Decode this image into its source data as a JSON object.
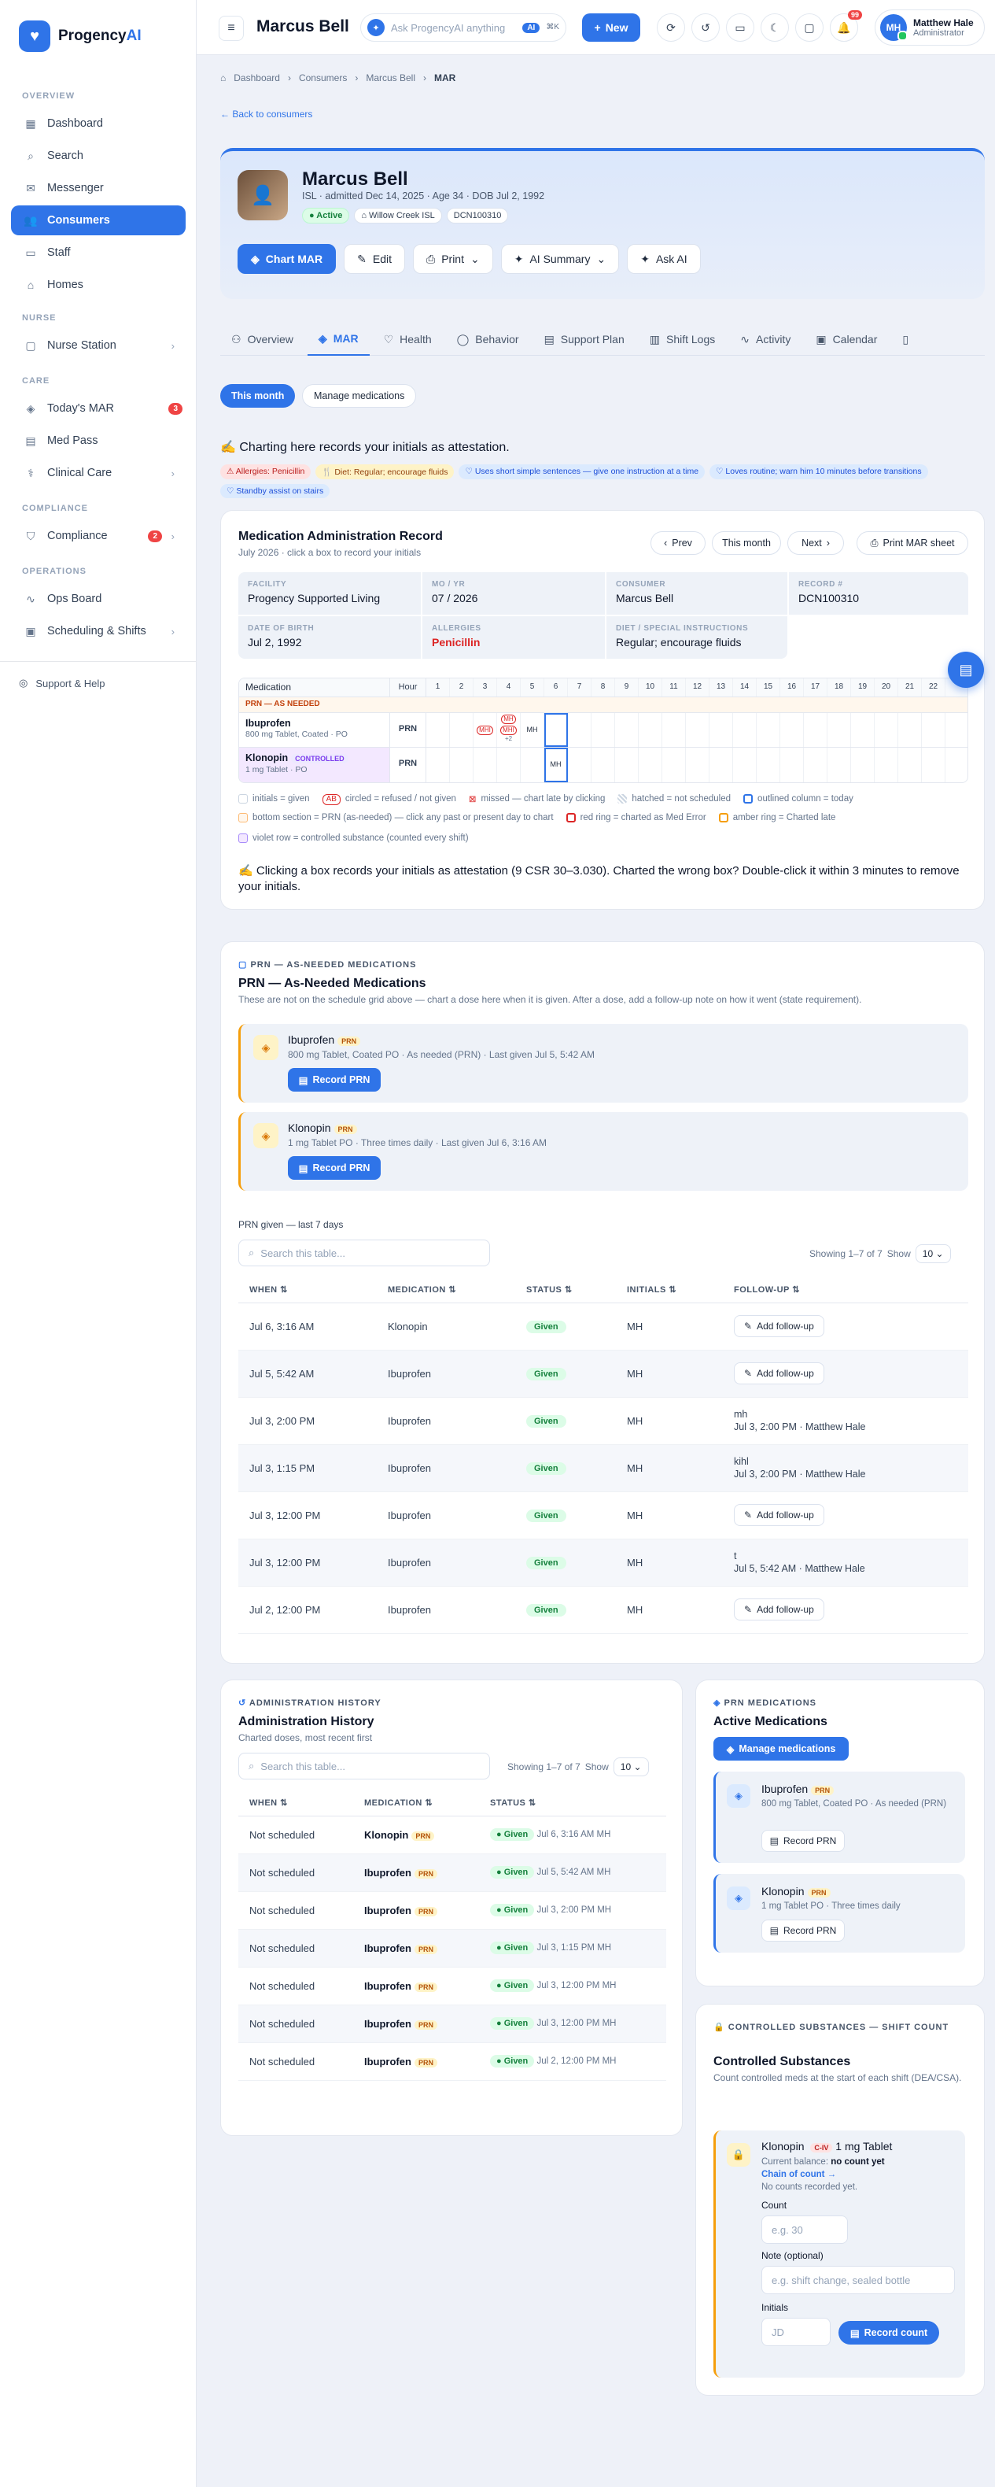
{
  "app": {
    "name_part1": "Progency",
    "name_part2": "AI"
  },
  "sidebar": {
    "sections": [
      "OVERVIEW",
      "NURSE",
      "CARE",
      "COMPLIANCE",
      "OPERATIONS"
    ],
    "items": [
      {
        "label": "Dashboard",
        "icon": "dashboard-icon"
      },
      {
        "label": "Search",
        "icon": "search-icon"
      },
      {
        "label": "Messenger",
        "icon": "chat-icon"
      },
      {
        "label": "Consumers",
        "icon": "users-icon",
        "active": true
      },
      {
        "label": "Staff",
        "icon": "staff-icon"
      },
      {
        "label": "Homes",
        "icon": "home-icon"
      },
      {
        "label": "Nurse Station",
        "icon": "monitor-icon"
      },
      {
        "label": "Today's MAR",
        "icon": "pill-icon",
        "badge": "3"
      },
      {
        "label": "Med Pass",
        "icon": "clipboard-icon"
      },
      {
        "label": "Clinical Care",
        "icon": "stethoscope-icon"
      },
      {
        "label": "Compliance",
        "icon": "shield-icon",
        "badge": "2"
      },
      {
        "label": "Ops Board",
        "icon": "pulse-icon"
      },
      {
        "label": "Scheduling & Shifts",
        "icon": "calendar-icon"
      }
    ],
    "support": "Support & Help"
  },
  "header": {
    "title": "Marcus Bell",
    "ask_placeholder": "Ask ProgencyAI anything",
    "ai_badge": "AI",
    "kbd": "⌘K",
    "new_label": "New",
    "notif_count": "99",
    "user_initials": "MH",
    "user_name": "Matthew Hale",
    "user_role": "Administrator"
  },
  "breadcrumb": [
    "Dashboard",
    "Consumers",
    "Marcus Bell",
    "MAR"
  ],
  "back_label": "Back to consumers",
  "consumer": {
    "name": "Marcus Bell",
    "subtitle": "ISL · admitted Dec 14, 2025 · Age 34 · DOB Jul 2, 1992",
    "status": "Active",
    "home": "Willow Creek ISL",
    "record": "DCN100310"
  },
  "actions": [
    "Chart MAR",
    "Edit",
    "Print",
    "AI Summary",
    "Ask AI"
  ],
  "tabs": [
    "Overview",
    "MAR",
    "Health",
    "Behavior",
    "Support Plan",
    "Shift Logs",
    "Activity",
    "Calendar"
  ],
  "pills": {
    "month": "This month",
    "manage": "Manage medications"
  },
  "attestation": "Charting here records your initials as attestation.",
  "flags": [
    {
      "text": "Allergies: Penicillin",
      "tone": "red"
    },
    {
      "text": "Diet: Regular; encourage fluids",
      "tone": "amber"
    },
    {
      "text": "Uses short simple sentences — give one instruction at a time",
      "tone": "blue"
    },
    {
      "text": "Loves routine; warn him 10 minutes before transitions",
      "tone": "blue"
    },
    {
      "text": "Standby assist on stairs",
      "tone": "blue"
    }
  ],
  "mar": {
    "title": "Medication Administration Record",
    "subtitle": "July 2026 · click a box to record your initials",
    "prev": "Prev",
    "this_month": "This month",
    "next": "Next",
    "print": "Print MAR sheet",
    "info": [
      {
        "k": "FACILITY",
        "v": "Progency Supported Living"
      },
      {
        "k": "MO / YR",
        "v": "07 / 2026"
      },
      {
        "k": "CONSUMER",
        "v": "Marcus Bell"
      },
      {
        "k": "RECORD #",
        "v": "DCN100310"
      },
      {
        "k": "DATE OF BIRTH",
        "v": "Jul 2, 1992"
      },
      {
        "k": "ALLERGIES",
        "v": "Penicillin"
      },
      {
        "k": "DIET / SPECIAL INSTRUCTIONS",
        "v": "Regular; encourage fluids"
      }
    ],
    "grid_header": {
      "med": "Medication",
      "hour": "Hour"
    },
    "days": [
      "1",
      "2",
      "3",
      "4",
      "5",
      "6",
      "7",
      "8",
      "9",
      "10",
      "11",
      "12",
      "13",
      "14",
      "15",
      "16",
      "17",
      "18",
      "19",
      "20",
      "21",
      "22"
    ],
    "prn_label": "PRN — AS NEEDED",
    "meds": [
      {
        "name": "Ibuprofen",
        "desc": "800 mg Tablet, Coated · PO",
        "hour": "PRN",
        "day3": "MHI",
        "day4_top": "MH",
        "day4_mid": "MHI",
        "day4_extra": "+2",
        "day5": "MH"
      },
      {
        "name": "Klonopin",
        "badge": "CONTROLLED",
        "desc": "1 mg Tablet · PO",
        "hour": "PRN",
        "day6": "MH"
      }
    ],
    "legend1": [
      "initials = given",
      "AB",
      "circled = refused / not given",
      "missed — chart late by clicking",
      "hatched = not scheduled",
      "outlined column = today"
    ],
    "legend2": [
      "bottom section = PRN (as-needed) — click any past or present day to chart",
      "red ring = charted as Med Error",
      "amber ring = Charted late"
    ],
    "legend3": "violet row = controlled substance (counted every shift)",
    "footnote": "Clicking a box records your initials as attestation (9 CSR 30–3.030). Charted the wrong box? Double-click it within 3 minutes to remove your initials."
  },
  "prn": {
    "eyebrow": "PRN — AS-NEEDED MEDICATIONS",
    "title": "PRN — As-Needed Medications",
    "subtitle": "These are not on the schedule grid above — chart a dose here when it is given. After a dose, add a follow-up note on how it went (state requirement).",
    "cards": [
      {
        "name": "Ibuprofen",
        "badge": "PRN",
        "desc": "800 mg Tablet, Coated PO · As needed (PRN) · Last given Jul 5, 5:42 AM",
        "btn": "Record PRN"
      },
      {
        "name": "Klonopin",
        "badge": "PRN",
        "desc": "1 mg Tablet PO · Three times daily · Last given Jul 6, 3:16 AM",
        "btn": "Record PRN"
      }
    ],
    "given_label": "PRN given — last 7 days",
    "search_placeholder": "Search this table...",
    "showing": "Showing 1–7 of 7",
    "show_label": "Show",
    "page_size": "10",
    "columns": [
      "WHEN",
      "MEDICATION",
      "STATUS",
      "INITIALS",
      "FOLLOW-UP"
    ],
    "rows": [
      {
        "when": "Jul 6, 3:16 AM",
        "med": "Klonopin",
        "status": "Given",
        "initials": "MH",
        "fu_btn": "Add follow-up"
      },
      {
        "when": "Jul 5, 5:42 AM",
        "med": "Ibuprofen",
        "status": "Given",
        "initials": "MH",
        "fu_btn": "Add follow-up"
      },
      {
        "when": "Jul 3, 2:00 PM",
        "med": "Ibuprofen",
        "status": "Given",
        "initials": "MH",
        "fu_note": "mh",
        "fu_meta": "Jul 3, 2:00 PM · Matthew Hale"
      },
      {
        "when": "Jul 3, 1:15 PM",
        "med": "Ibuprofen",
        "status": "Given",
        "initials": "MH",
        "fu_note": "kihl",
        "fu_meta": "Jul 3, 2:00 PM · Matthew Hale"
      },
      {
        "when": "Jul 3, 12:00 PM",
        "med": "Ibuprofen",
        "status": "Given",
        "initials": "MH",
        "fu_btn": "Add follow-up"
      },
      {
        "when": "Jul 3, 12:00 PM",
        "med": "Ibuprofen",
        "status": "Given",
        "initials": "MH",
        "fu_note": "t",
        "fu_meta": "Jul 5, 5:42 AM · Matthew Hale"
      },
      {
        "when": "Jul 2, 12:00 PM",
        "med": "Ibuprofen",
        "status": "Given",
        "initials": "MH",
        "fu_btn": "Add follow-up"
      }
    ]
  },
  "history": {
    "eyebrow": "ADMINISTRATION HISTORY",
    "title": "Administration History",
    "subtitle": "Charted doses, most recent first",
    "search_placeholder": "Search this table...",
    "showing": "Showing 1–7 of 7",
    "show_label": "Show",
    "page_size": "10",
    "columns": [
      "WHEN",
      "MEDICATION",
      "STATUS"
    ],
    "rows": [
      {
        "when": "Not scheduled",
        "med": "Klonopin",
        "badge": "PRN",
        "status": "Given",
        "meta": "Jul 6, 3:16 AM MH"
      },
      {
        "when": "Not scheduled",
        "med": "Ibuprofen",
        "badge": "PRN",
        "status": "Given",
        "meta": "Jul 5, 5:42 AM MH"
      },
      {
        "when": "Not scheduled",
        "med": "Ibuprofen",
        "badge": "PRN",
        "status": "Given",
        "meta": "Jul 3, 2:00 PM MH"
      },
      {
        "when": "Not scheduled",
        "med": "Ibuprofen",
        "badge": "PRN",
        "status": "Given",
        "meta": "Jul 3, 1:15 PM MH"
      },
      {
        "when": "Not scheduled",
        "med": "Ibuprofen",
        "badge": "PRN",
        "status": "Given",
        "meta": "Jul 3, 12:00 PM MH"
      },
      {
        "when": "Not scheduled",
        "med": "Ibuprofen",
        "badge": "PRN",
        "status": "Given",
        "meta": "Jul 3, 12:00 PM MH"
      },
      {
        "when": "Not scheduled",
        "med": "Ibuprofen",
        "badge": "PRN",
        "status": "Given",
        "meta": "Jul 2, 12:00 PM MH"
      }
    ]
  },
  "active": {
    "eyebrow": "PRN MEDICATIONS",
    "title": "Active Medications",
    "manage": "Manage medications",
    "cards": [
      {
        "name": "Ibuprofen",
        "badge": "PRN",
        "desc": "800 mg Tablet, Coated PO · As needed (PRN)",
        "btn": "Record PRN"
      },
      {
        "name": "Klonopin",
        "badge": "PRN",
        "desc": "1 mg Tablet PO · Three times daily",
        "btn": "Record PRN"
      }
    ]
  },
  "controlled": {
    "eyebrow": "CONTROLLED SUBSTANCES — SHIFT COUNT",
    "title": "Controlled Substances",
    "subtitle": "Count controlled meds at the start of each shift (DEA/CSA).",
    "med": "Klonopin",
    "schedule": "C-IV",
    "strength": "1 mg Tablet",
    "balance_label": "Current balance:",
    "balance_value": "no count yet",
    "chain": "Chain of count →",
    "no_counts": "No counts recorded yet.",
    "count_label": "Count",
    "count_placeholder": "e.g. 30",
    "note_label": "Note (optional)",
    "note_placeholder": "e.g. shift change, sealed bottle",
    "initials_label": "Initials",
    "initials_placeholder": "JD",
    "record_btn": "Record count"
  }
}
